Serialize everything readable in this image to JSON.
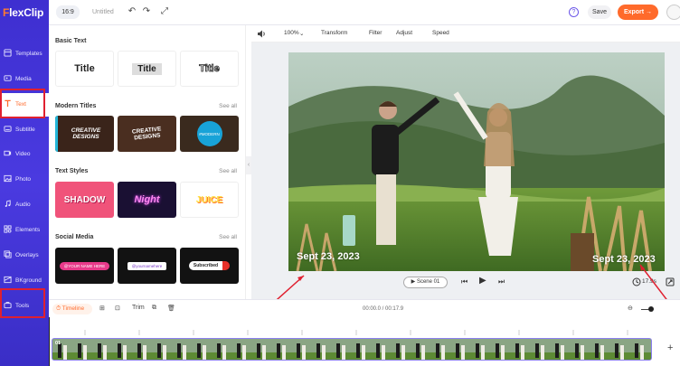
{
  "app": {
    "logo": "FlexClip"
  },
  "topbar": {
    "ratio": "16:9",
    "project_title": "Untitled",
    "help": "?",
    "save_label": "Save",
    "export_label": "Export →"
  },
  "sidebar": {
    "items": [
      {
        "label": "Templates",
        "icon": "templates-icon"
      },
      {
        "label": "Media",
        "icon": "media-icon"
      },
      {
        "label": "Text",
        "icon": "text-icon",
        "active": true
      },
      {
        "label": "Subtitle",
        "icon": "subtitle-icon"
      },
      {
        "label": "Video",
        "icon": "video-icon"
      },
      {
        "label": "Photo",
        "icon": "photo-icon"
      },
      {
        "label": "Audio",
        "icon": "audio-icon"
      },
      {
        "label": "Elements",
        "icon": "elements-icon"
      },
      {
        "label": "Overlays",
        "icon": "overlays-icon"
      },
      {
        "label": "BKground",
        "icon": "background-icon"
      },
      {
        "label": "Tools",
        "icon": "tools-icon"
      }
    ]
  },
  "panel": {
    "basic_text": {
      "title": "Basic Text",
      "cards": [
        "Title",
        "Title",
        "Title"
      ]
    },
    "modern_titles": {
      "title": "Modern Titles",
      "see_all": "See all",
      "cards": [
        "CREATIVE DESIGNS",
        "CREATIVE DESIGNS",
        "#MODERN"
      ]
    },
    "text_styles": {
      "title": "Text Styles",
      "see_all": "See all",
      "cards": [
        "SHADOW",
        "Night",
        "JUICE"
      ]
    },
    "social_media": {
      "title": "Social Media",
      "see_all": "See all",
      "cards": [
        "@YOUR NAME HERE",
        "@yournamehere",
        "Subscribed"
      ]
    }
  },
  "canvas_toolbar": {
    "zoom": "100%",
    "transform": "Transform",
    "filter": "Filter",
    "adjust": "Adjust",
    "speed": "Speed"
  },
  "stage": {
    "date_left": "Sept 23, 2023",
    "date_right": "Sept 23, 2023",
    "scene_label": "Scene 01",
    "duration": "17.9s"
  },
  "timeline": {
    "label": "Timeline",
    "trim": "Trim",
    "time": "00:00.0 / 00:17.9",
    "clip_number": "01",
    "add": "+"
  },
  "colors": {
    "accent": "#ff6a2b",
    "rail": "#4a3ae0",
    "highlight": "#e02030"
  }
}
